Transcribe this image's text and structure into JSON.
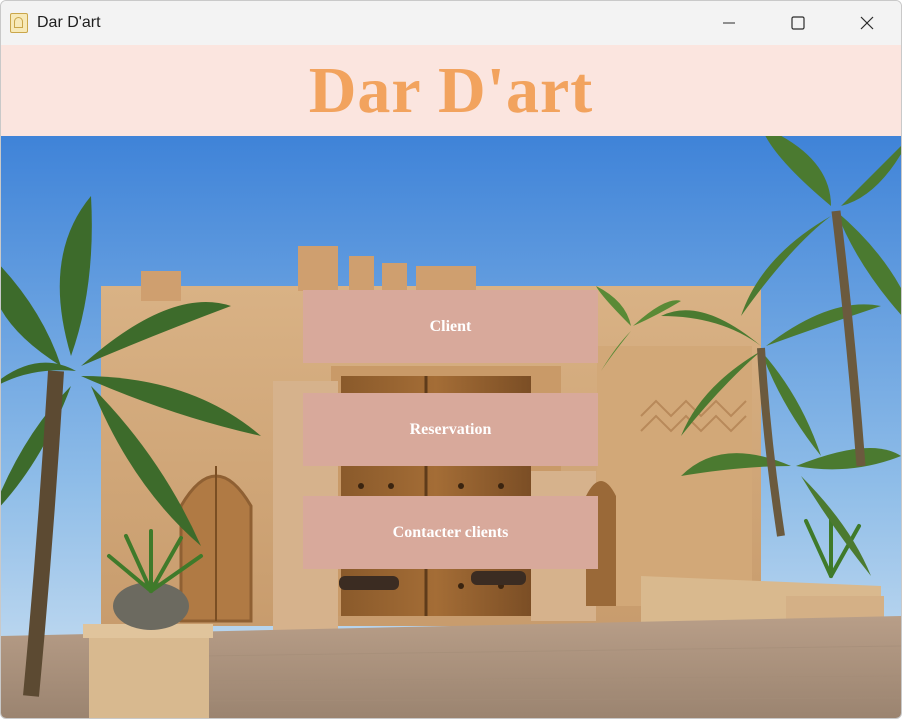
{
  "window": {
    "title": "Dar D'art",
    "app_icon": "building-icon",
    "controls": [
      "minimize-icon",
      "maximize-icon",
      "close-icon"
    ]
  },
  "header": {
    "heading": "Dar D'art",
    "background": "#fbe5df",
    "heading_color": "#f2a35e"
  },
  "menu": {
    "button_color": "#d8a99b",
    "text_color": "#ffffff",
    "items": [
      {
        "label": "Client"
      },
      {
        "label": "Reservation"
      },
      {
        "label": "Contacter clients"
      }
    ]
  },
  "background_image": {
    "description_icon": "riad-photo"
  }
}
